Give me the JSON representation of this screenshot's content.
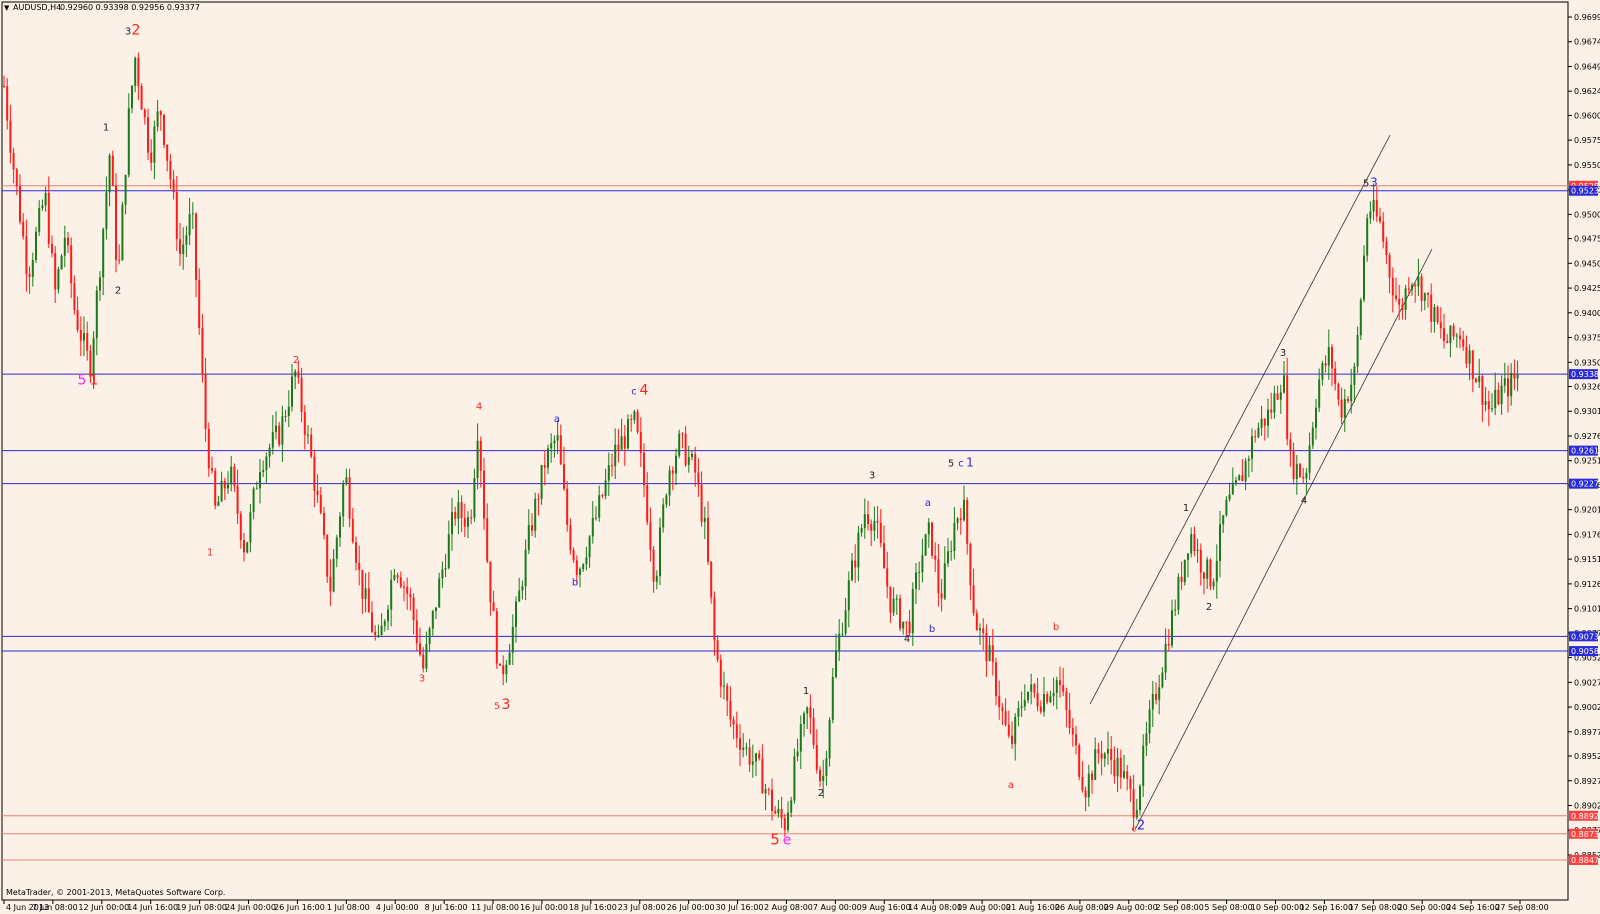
{
  "header": {
    "symbol_title": "AUDUSD,H4",
    "ohlc": "0.92960 0.93398 0.92956 0.93377",
    "menu_glyph": "▼"
  },
  "footer": {
    "copyright": "MetaTrader, © 2001-2013, MetaQuotes Software Corp."
  },
  "colors": {
    "background": "#fcf1e6",
    "bull": "#1a7a1a",
    "bear": "#ff1a1a",
    "hline_blue": "#2a2ad6",
    "hline_red": "#f08070",
    "label_blue": "#2a2ad6",
    "label_red": "#ff2020",
    "label_magenta": "#ff22ff",
    "label_black": "#222222"
  },
  "chart_data": {
    "type": "candlestick",
    "symbol": "AUDUSD",
    "timeframe": "H4",
    "ylim": [
      0.88474,
      0.96995
    ],
    "y_ticks": [
      "0.96995",
      "0.96745",
      "0.96495",
      "0.96245",
      "0.96000",
      "0.95750",
      "0.95500",
      "0.95250",
      "0.95000",
      "0.94755",
      "0.94505",
      "0.94255",
      "0.94005",
      "0.93755",
      "0.93505",
      "0.93260",
      "0.93010",
      "0.92760",
      "0.92510",
      "0.92265",
      "0.92015",
      "0.91765",
      "0.91515",
      "0.91265",
      "0.91015",
      "0.90770",
      "0.90520",
      "0.90270",
      "0.90020",
      "0.89770",
      "0.89525",
      "0.89275",
      "0.89025",
      "0.88775",
      "0.88525"
    ],
    "x_ticks": [
      "4 Jun 2013",
      "7 Jun 08:00",
      "12 Jun 00:00",
      "14 Jun 16:00",
      "19 Jun 08:00",
      "24 Jun 00:00",
      "26 Jun 16:00",
      "1 Jul 08:00",
      "4 Jul 00:00",
      "8 Jul 16:00",
      "11 Jul 08:00",
      "16 Jul 00:00",
      "18 Jul 16:00",
      "23 Jul 08:00",
      "26 Jul 00:00",
      "30 Jul 16:00",
      "2 Aug 08:00",
      "7 Aug 00:00",
      "9 Aug 16:00",
      "14 Aug 08:00",
      "19 Aug 00:00",
      "21 Aug 16:00",
      "26 Aug 08:00",
      "29 Aug 00:00",
      "2 Sep 08:00",
      "5 Sep 08:00",
      "10 Sep 00:00",
      "12 Sep 16:00",
      "17 Sep 08:00",
      "20 Sep 00:00",
      "24 Sep 16:00",
      "27 Sep 08:00"
    ],
    "price_levels": [
      {
        "price": "0.95289",
        "color": "#f08070",
        "badge": "#ff4040"
      },
      {
        "price": "0.95239",
        "color": "#2a2ad6",
        "badge": "#2a2ad6"
      },
      {
        "price": "0.93385",
        "color": "#2a2ad6",
        "badge": "#2a2ad6"
      },
      {
        "price": "0.92612",
        "color": "#2a2ad6",
        "badge": "#2a2ad6"
      },
      {
        "price": "0.92278",
        "color": "#2a2ad6",
        "badge": "#2a2ad6"
      },
      {
        "price": "0.90735",
        "color": "#2a2ad6",
        "badge": "#2a2ad6"
      },
      {
        "price": "0.90586",
        "color": "#2a2ad6",
        "badge": "#2a2ad6"
      },
      {
        "price": "0.88921",
        "color": "#f08070",
        "badge": "#ff4040"
      },
      {
        "price": "0.88739",
        "color": "#f08070",
        "badge": "#ff4040"
      },
      {
        "price": "0.88474",
        "color": "#f08070",
        "badge": "#ff4040"
      }
    ],
    "path_points": [
      [
        0,
        0.9665
      ],
      [
        12,
        0.956
      ],
      [
        28,
        0.944
      ],
      [
        45,
        0.952
      ],
      [
        55,
        0.942
      ],
      [
        65,
        0.948
      ],
      [
        75,
        0.94
      ],
      [
        90,
        0.9345
      ],
      [
        100,
        0.945
      ],
      [
        110,
        0.9565
      ],
      [
        118,
        0.943
      ],
      [
        128,
        0.959
      ],
      [
        135,
        0.966
      ],
      [
        150,
        0.956
      ],
      [
        160,
        0.961
      ],
      [
        170,
        0.954
      ],
      [
        180,
        0.946
      ],
      [
        192,
        0.95
      ],
      [
        205,
        0.929
      ],
      [
        215,
        0.92
      ],
      [
        230,
        0.924
      ],
      [
        245,
        0.916
      ],
      [
        260,
        0.925
      ],
      [
        280,
        0.928
      ],
      [
        295,
        0.934
      ],
      [
        310,
        0.926
      ],
      [
        322,
        0.918
      ],
      [
        330,
        0.912
      ],
      [
        345,
        0.924
      ],
      [
        360,
        0.913
      ],
      [
        378,
        0.906
      ],
      [
        395,
        0.915
      ],
      [
        410,
        0.911
      ],
      [
        423,
        0.904
      ],
      [
        440,
        0.913
      ],
      [
        455,
        0.92
      ],
      [
        470,
        0.919
      ],
      [
        478,
        0.929
      ],
      [
        488,
        0.914
      ],
      [
        500,
        0.903
      ],
      [
        515,
        0.909
      ],
      [
        530,
        0.918
      ],
      [
        545,
        0.925
      ],
      [
        557,
        0.9275
      ],
      [
        568,
        0.918
      ],
      [
        578,
        0.914
      ],
      [
        595,
        0.919
      ],
      [
        615,
        0.926
      ],
      [
        635,
        0.929
      ],
      [
        645,
        0.922
      ],
      [
        655,
        0.913
      ],
      [
        668,
        0.924
      ],
      [
        680,
        0.927
      ],
      [
        695,
        0.924
      ],
      [
        705,
        0.918
      ],
      [
        715,
        0.906
      ],
      [
        730,
        0.899
      ],
      [
        745,
        0.896
      ],
      [
        758,
        0.894
      ],
      [
        775,
        0.8895
      ],
      [
        785,
        0.8885
      ],
      [
        798,
        0.896
      ],
      [
        808,
        0.9
      ],
      [
        822,
        0.892
      ],
      [
        835,
        0.905
      ],
      [
        850,
        0.913
      ],
      [
        865,
        0.92
      ],
      [
        875,
        0.919
      ],
      [
        890,
        0.911
      ],
      [
        908,
        0.908
      ],
      [
        920,
        0.915
      ],
      [
        930,
        0.918
      ],
      [
        940,
        0.911
      ],
      [
        955,
        0.919
      ],
      [
        963,
        0.921
      ],
      [
        975,
        0.909
      ],
      [
        990,
        0.905
      ],
      [
        1010,
        0.896
      ],
      [
        1025,
        0.902
      ],
      [
        1040,
        0.901
      ],
      [
        1058,
        0.903
      ],
      [
        1070,
        0.898
      ],
      [
        1085,
        0.892
      ],
      [
        1100,
        0.896
      ],
      [
        1120,
        0.894
      ],
      [
        1135,
        0.89
      ],
      [
        1150,
        0.899
      ],
      [
        1165,
        0.906
      ],
      [
        1178,
        0.912
      ],
      [
        1190,
        0.918
      ],
      [
        1200,
        0.915
      ],
      [
        1212,
        0.913
      ],
      [
        1225,
        0.92
      ],
      [
        1240,
        0.923
      ],
      [
        1255,
        0.928
      ],
      [
        1270,
        0.93
      ],
      [
        1283,
        0.934
      ],
      [
        1290,
        0.925
      ],
      [
        1305,
        0.9235
      ],
      [
        1318,
        0.933
      ],
      [
        1330,
        0.936
      ],
      [
        1340,
        0.93
      ],
      [
        1355,
        0.934
      ],
      [
        1368,
        0.951
      ],
      [
        1380,
        0.949
      ],
      [
        1390,
        0.944
      ],
      [
        1400,
        0.94
      ],
      [
        1410,
        0.944
      ],
      [
        1420,
        0.943
      ],
      [
        1432,
        0.94
      ],
      [
        1445,
        0.937
      ],
      [
        1460,
        0.938
      ],
      [
        1475,
        0.934
      ],
      [
        1490,
        0.93
      ],
      [
        1500,
        0.932
      ],
      [
        1512,
        0.933
      ],
      [
        1518,
        0.9338
      ]
    ],
    "trendlines": [
      {
        "x1": 1090,
        "p1": 0.9005,
        "x2": 1390,
        "p2": 0.958
      },
      {
        "x1": 1135,
        "p1": 0.8878,
        "x2": 1432,
        "p2": 0.9465
      }
    ],
    "wave_labels": [
      {
        "text": "3",
        "x": 128,
        "p": 0.9682,
        "color": "black",
        "size": 10
      },
      {
        "text": "2",
        "x": 136,
        "p": 0.9682,
        "color": "red",
        "size": 14
      },
      {
        "text": "1",
        "x": 106,
        "p": 0.9585,
        "color": "black",
        "size": 10
      },
      {
        "text": "2",
        "x": 118,
        "p": 0.942,
        "color": "black",
        "size": 10
      },
      {
        "text": "5",
        "x": 82,
        "p": 0.9328,
        "color": "magenta",
        "size": 14
      },
      {
        "text": "1",
        "x": 94,
        "p": 0.9328,
        "color": "red",
        "size": 14
      },
      {
        "text": "2",
        "x": 296,
        "p": 0.935,
        "color": "red",
        "size": 10
      },
      {
        "text": "1",
        "x": 210,
        "p": 0.9155,
        "color": "red",
        "size": 10
      },
      {
        "text": "3",
        "x": 422,
        "p": 0.9028,
        "color": "red",
        "size": 10
      },
      {
        "text": "4",
        "x": 479,
        "p": 0.9303,
        "color": "red",
        "size": 10
      },
      {
        "text": "5",
        "x": 497,
        "p": 0.9,
        "color": "red",
        "size": 9
      },
      {
        "text": "3",
        "x": 506,
        "p": 0.9,
        "color": "red",
        "size": 14
      },
      {
        "text": "a",
        "x": 557,
        "p": 0.929,
        "color": "blue",
        "size": 10
      },
      {
        "text": "b",
        "x": 575,
        "p": 0.9125,
        "color": "blue",
        "size": 10
      },
      {
        "text": "c",
        "x": 634,
        "p": 0.9318,
        "color": "blue",
        "size": 10
      },
      {
        "text": "4",
        "x": 644,
        "p": 0.9318,
        "color": "red",
        "size": 14
      },
      {
        "text": "5",
        "x": 775,
        "p": 0.8863,
        "color": "red",
        "size": 15
      },
      {
        "text": "e",
        "x": 787,
        "p": 0.8863,
        "color": "magenta",
        "size": 14
      },
      {
        "text": "1",
        "x": 806,
        "p": 0.9015,
        "color": "black",
        "size": 10
      },
      {
        "text": "2",
        "x": 821,
        "p": 0.8912,
        "color": "black",
        "size": 10
      },
      {
        "text": "3",
        "x": 872,
        "p": 0.9233,
        "color": "black",
        "size": 10
      },
      {
        "text": "a",
        "x": 928,
        "p": 0.9205,
        "color": "blue",
        "size": 10
      },
      {
        "text": "4",
        "x": 907,
        "p": 0.9068,
        "color": "black",
        "size": 10
      },
      {
        "text": "b",
        "x": 932,
        "p": 0.9078,
        "color": "blue",
        "size": 10
      },
      {
        "text": "5",
        "x": 951,
        "p": 0.9245,
        "color": "black",
        "size": 10
      },
      {
        "text": "c",
        "x": 961,
        "p": 0.9245,
        "color": "blue",
        "size": 10
      },
      {
        "text": "1",
        "x": 970,
        "p": 0.9245,
        "color": "blue",
        "size": 12
      },
      {
        "text": "b",
        "x": 1056,
        "p": 0.908,
        "color": "red",
        "size": 10
      },
      {
        "text": "a",
        "x": 1011,
        "p": 0.892,
        "color": "red",
        "size": 10
      },
      {
        "text": "c",
        "x": 1134,
        "p": 0.8876,
        "color": "red",
        "size": 9
      },
      {
        "text": "2",
        "x": 1141,
        "p": 0.8878,
        "color": "blue",
        "size": 13
      },
      {
        "text": "1",
        "x": 1186,
        "p": 0.92,
        "color": "black",
        "size": 10
      },
      {
        "text": "2",
        "x": 1209,
        "p": 0.91,
        "color": "black",
        "size": 10
      },
      {
        "text": "3",
        "x": 1283,
        "p": 0.9357,
        "color": "black",
        "size": 10
      },
      {
        "text": "4",
        "x": 1304,
        "p": 0.9208,
        "color": "black",
        "size": 10
      },
      {
        "text": "5",
        "x": 1366,
        "p": 0.9528,
        "color": "black",
        "size": 10
      },
      {
        "text": "3",
        "x": 1374,
        "p": 0.9528,
        "color": "blue",
        "size": 12
      }
    ]
  }
}
